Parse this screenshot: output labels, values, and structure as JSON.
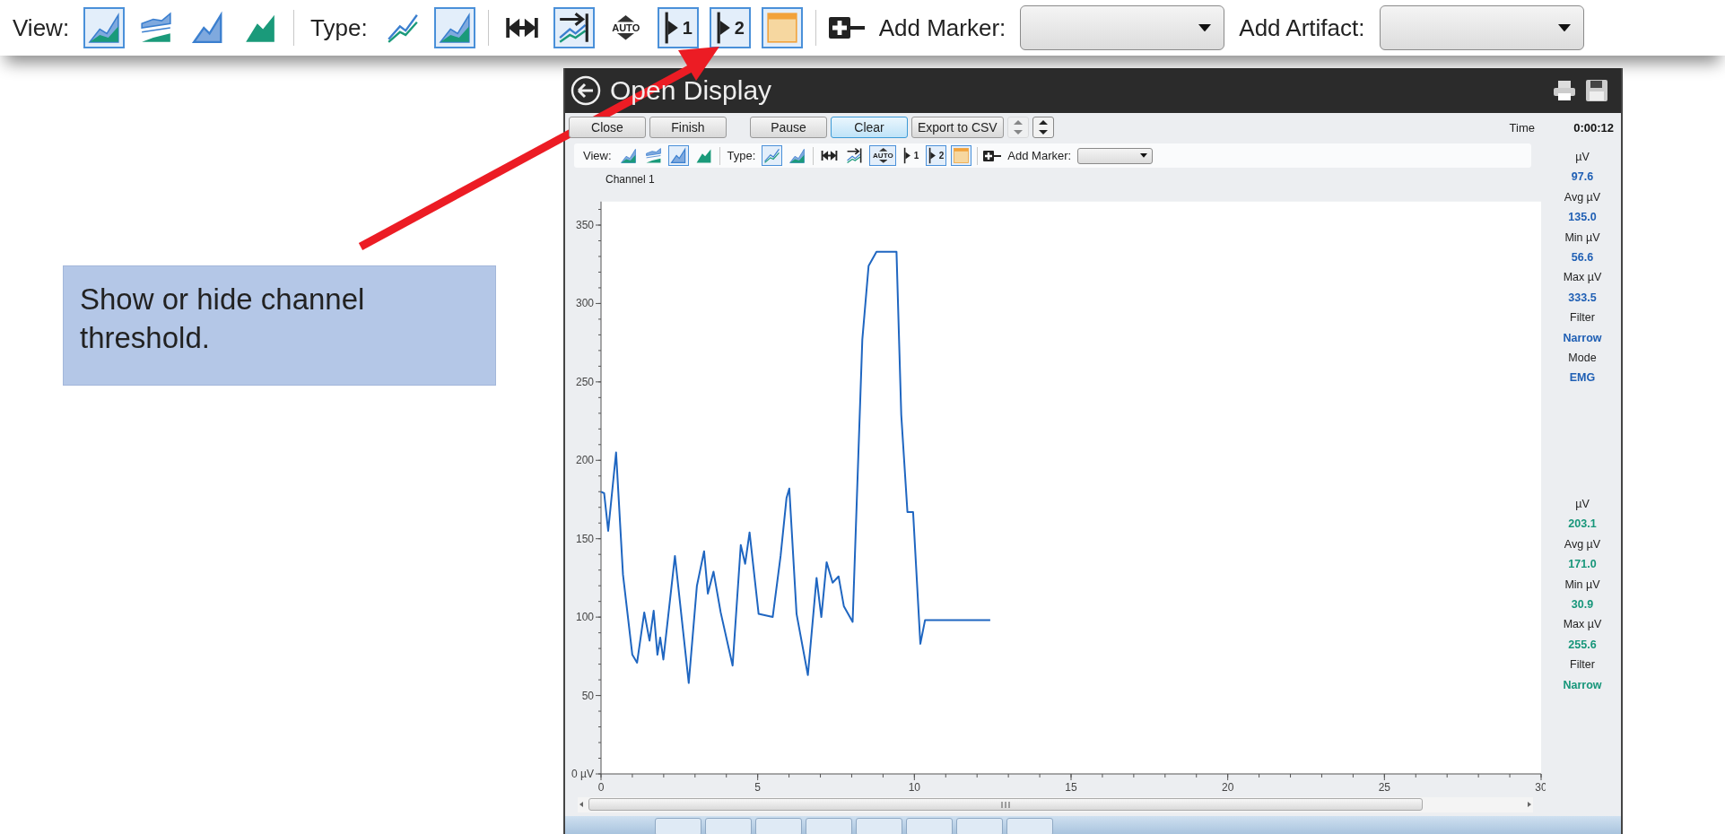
{
  "top_toolbar": {
    "view_label": "View:",
    "view_buttons": [
      {
        "kind": "area-overlay",
        "selected": true
      },
      {
        "kind": "area-stack",
        "selected": false
      },
      {
        "kind": "area-blue",
        "selected": false
      },
      {
        "kind": "area-teal",
        "selected": false
      }
    ],
    "type_label": "Type:",
    "type_buttons": [
      {
        "kind": "lines",
        "selected": false
      },
      {
        "kind": "areas",
        "selected": true
      }
    ],
    "tool_buttons": [
      {
        "kind": "fit",
        "selected": false
      },
      {
        "kind": "scroll",
        "selected": true
      },
      {
        "kind": "auto",
        "label": "AUTO",
        "selected": false
      },
      {
        "kind": "threshold",
        "label": "1",
        "selected": true
      },
      {
        "kind": "threshold",
        "label": "2",
        "selected": true
      },
      {
        "kind": "color",
        "selected": true
      }
    ],
    "marker_label": "Add Marker:",
    "artifact_label": "Add Artifact:"
  },
  "callout": {
    "text": "Show or hide channel threshold."
  },
  "window": {
    "title": "Open Display",
    "buttons": [
      {
        "label": "Close",
        "selected": false
      },
      {
        "label": "Finish",
        "selected": false
      },
      {
        "label": "Pause",
        "selected": false
      },
      {
        "label": "Clear",
        "selected": true
      },
      {
        "label": "Export to CSV",
        "selected": false
      }
    ],
    "spinners": [
      {
        "disabled": true
      },
      {
        "disabled": false
      }
    ],
    "time_label": "Time",
    "time_value": "0:00:12",
    "toolbar": {
      "view_label": "View:",
      "view_buttons": [
        {
          "kind": "area-overlay",
          "selected": false
        },
        {
          "kind": "area-stack",
          "selected": false
        },
        {
          "kind": "area-blue",
          "selected": true
        },
        {
          "kind": "area-teal",
          "selected": false
        }
      ],
      "type_label": "Type:",
      "type_buttons": [
        {
          "kind": "lines",
          "selected": true
        },
        {
          "kind": "areas",
          "selected": false
        }
      ],
      "tool_buttons": [
        {
          "kind": "fit",
          "selected": false
        },
        {
          "kind": "scroll",
          "selected": false
        },
        {
          "kind": "auto",
          "label": "AUTO",
          "selected": true
        },
        {
          "kind": "threshold",
          "label": "1",
          "selected": false
        },
        {
          "kind": "threshold",
          "label": "2",
          "selected": true
        },
        {
          "kind": "color",
          "selected": true
        }
      ],
      "marker_label": "Add Marker:"
    },
    "chart_data": {
      "type": "line",
      "x": [
        0,
        0.1,
        0.23,
        0.48,
        0.7,
        1.0,
        1.15,
        1.38,
        1.55,
        1.68,
        1.8,
        1.89,
        1.99,
        2.36,
        2.8,
        3.06,
        3.29,
        3.41,
        3.59,
        3.82,
        4.2,
        4.46,
        4.6,
        4.74,
        5.03,
        5.48,
        5.73,
        5.92,
        6.01,
        6.24,
        6.6,
        6.88,
        7.03,
        7.2,
        7.39,
        7.58,
        7.75,
        8.03,
        8.34,
        8.54,
        8.79,
        9.43,
        9.58,
        9.78,
        9.96,
        10.19,
        10.34,
        12.42
      ],
      "series": [
        {
          "name": "Channel 1",
          "color": "#1f66c1",
          "values": [
            180,
            179,
            155,
            205,
            127,
            76,
            71,
            103,
            85,
            104,
            76,
            87,
            73,
            139,
            58,
            120,
            142,
            115,
            129,
            103,
            69,
            146,
            134,
            154,
            102,
            100,
            139,
            176,
            182,
            102,
            63,
            125,
            100,
            135,
            122,
            126,
            107,
            97,
            277,
            324,
            333,
            333,
            229,
            167,
            167,
            83,
            98,
            98
          ]
        }
      ],
      "xlim": [
        0,
        30
      ],
      "ylim": [
        0,
        365
      ],
      "xticks": [
        0,
        5,
        10,
        15,
        20,
        25,
        30
      ],
      "yticks": [
        {
          "value": 0,
          "label": "0 µV"
        },
        50,
        100,
        150,
        200,
        250,
        300,
        350
      ]
    },
    "stat_groups": [
      {
        "color": "#1f5fb4",
        "items": [
          {
            "label": "µV",
            "value": "97.6"
          },
          {
            "label": "Avg µV",
            "value": "135.0"
          },
          {
            "label": "Min µV",
            "value": "56.6"
          },
          {
            "label": "Max µV",
            "value": "333.5"
          },
          {
            "label": "Filter",
            "value": "Narrow"
          },
          {
            "label": "Mode",
            "value": "EMG"
          }
        ]
      },
      {
        "color": "#17967a",
        "items": [
          {
            "label": "µV",
            "value": "203.1"
          },
          {
            "label": "Avg µV",
            "value": "171.0"
          },
          {
            "label": "Min µV",
            "value": "30.9"
          },
          {
            "label": "Max µV",
            "value": "255.6"
          },
          {
            "label": "Filter",
            "value": "Narrow"
          }
        ]
      }
    ]
  }
}
